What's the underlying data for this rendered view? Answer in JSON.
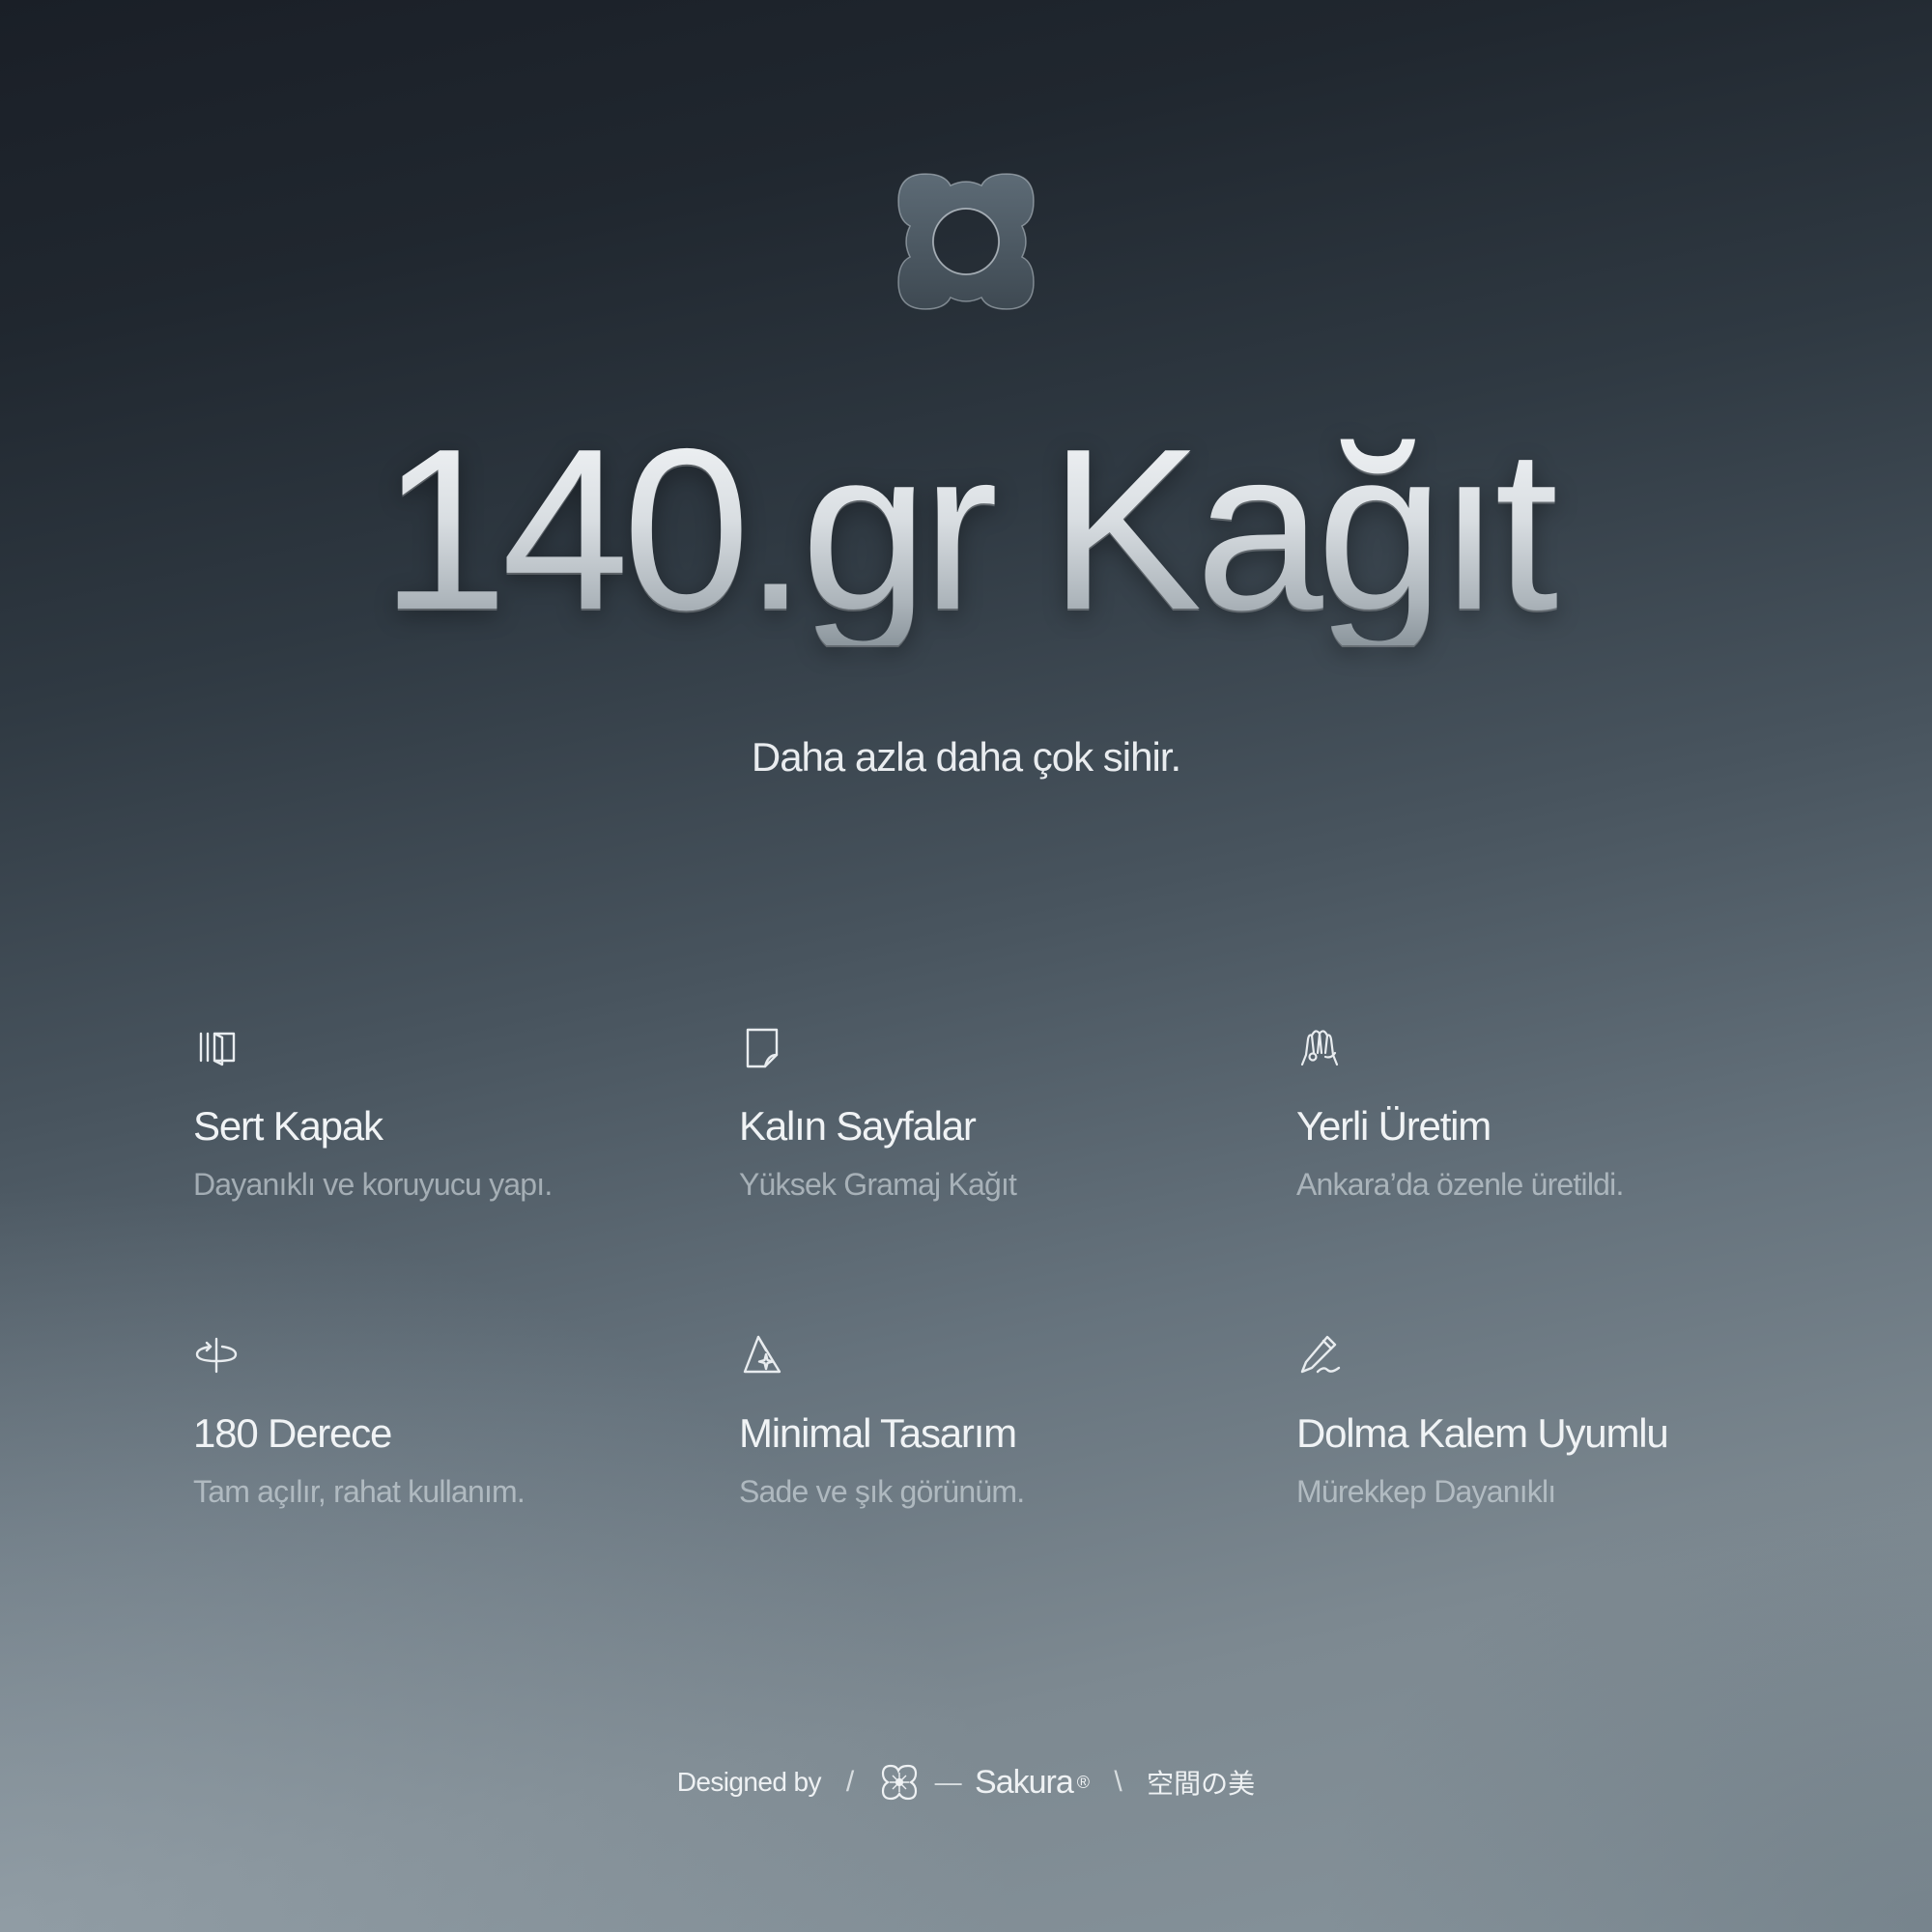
{
  "hero": {
    "title": "140.gr Kağıt",
    "subtitle": "Daha azla daha çok sihir."
  },
  "features": [
    {
      "icon": "book-cover-icon",
      "title": "Sert Kapak",
      "description": "Dayanıklı ve koruyucu yapı."
    },
    {
      "icon": "page-icon",
      "title": "Kalın Sayfalar",
      "description": "Yüksek Gramaj Kağıt"
    },
    {
      "icon": "hands-icon",
      "title": "Yerli Üretim",
      "description": "Ankara’da özenle üretildi."
    },
    {
      "icon": "rotate-180-icon",
      "title": "180 Derece",
      "description": "Tam açılır, rahat kullanım."
    },
    {
      "icon": "sparkle-triangle-icon",
      "title": "Minimal Tasarım",
      "description": "Sade ve şık görünüm."
    },
    {
      "icon": "pen-icon",
      "title": "Dolma Kalem Uyumlu",
      "description": "Mürekkep Dayanıklı"
    }
  ],
  "footer": {
    "designed_by": "Designed by",
    "slash": "/",
    "dash": "—",
    "brand": "Sakura",
    "registered": "®",
    "backslash": "\\",
    "tagline": "空間の美"
  }
}
